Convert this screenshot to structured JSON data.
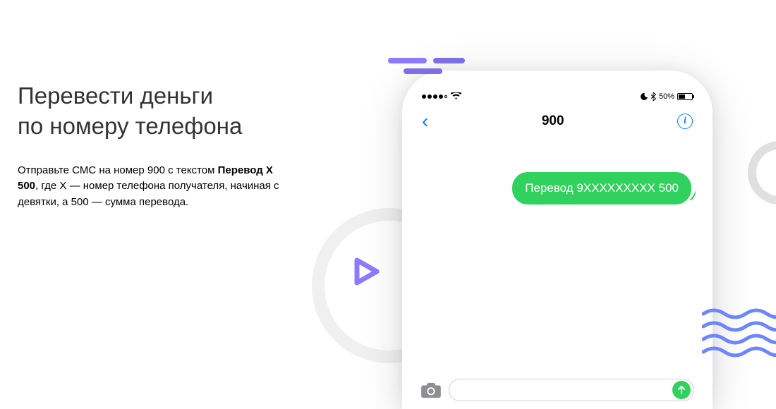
{
  "title": "Перевести деньги\nпо номеру телефона",
  "description_pre": "Отправьте СМС на номер 900 с текстом ",
  "description_bold": "Перевод X 500",
  "description_post": ", где X — номер телефона получателя, начиная с девятки, а 500 — сумма перевода.",
  "phone": {
    "status": {
      "battery_pct": "50%"
    },
    "nav": {
      "title": "900"
    },
    "message": "Перевод 9XXXXXXXXX 500"
  }
}
